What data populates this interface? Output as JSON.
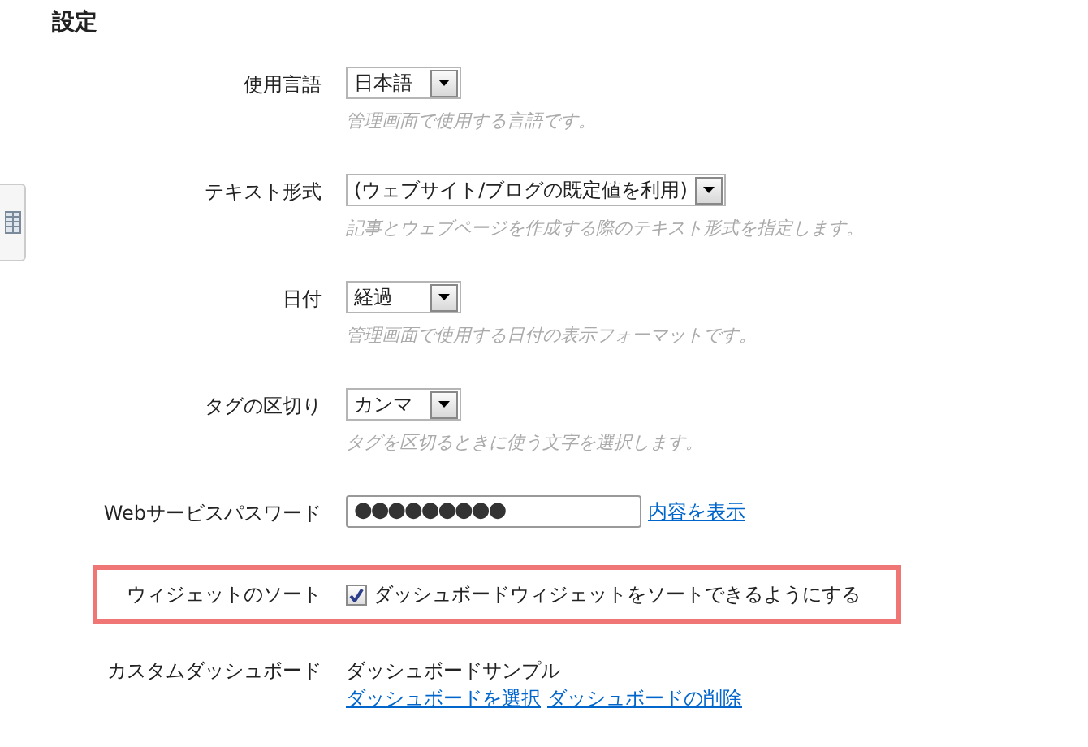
{
  "title": "設定",
  "settings": [
    {
      "kind": "select",
      "label": "使用言語",
      "value": "日本語",
      "hint": "管理画面で使用する言語です。",
      "highlighted": false
    },
    {
      "kind": "select",
      "label": "テキスト形式",
      "value": "(ウェブサイト/ブログの既定値を利用)",
      "hint": "記事とウェブページを作成する際のテキスト形式を指定します。",
      "highlighted": false
    },
    {
      "kind": "select",
      "label": "日付",
      "value": "経過",
      "hint": "管理画面で使用する日付の表示フォーマットです。",
      "highlighted": false
    },
    {
      "kind": "select",
      "label": "タグの区切り",
      "value": "カンマ",
      "hint": "タグを区切るときに使う文字を選択します。",
      "highlighted": false
    },
    {
      "kind": "password",
      "label": "Webサービスパスワード",
      "value": "●●●●●●●●●",
      "links": [
        "内容を表示"
      ],
      "highlighted": false
    },
    {
      "kind": "checkbox",
      "label": "ウィジェットのソート",
      "text": "ダッシュボードウィジェットをソートできるようにする",
      "checked": true,
      "highlighted": true
    },
    {
      "kind": "dashboard",
      "label": "カスタムダッシュボード",
      "value": "ダッシュボードサンプル",
      "links": [
        "ダッシュボードを選択",
        "ダッシュボードの削除"
      ],
      "highlighted": false
    }
  ]
}
